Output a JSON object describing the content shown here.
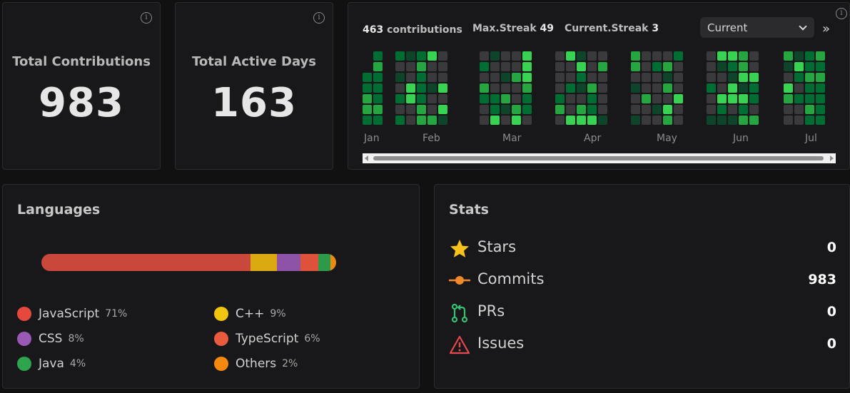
{
  "cards": {
    "total_contributions": {
      "label": "Total Contributions",
      "value": "983"
    },
    "total_active_days": {
      "label": "Total Active Days",
      "value": "163"
    }
  },
  "contributions": {
    "count_num": "463",
    "count_label": "contributions",
    "max_streak_label": "Max.Streak",
    "max_streak_value": "49",
    "current_streak_label": "Current.Streak",
    "current_streak_value": "3",
    "range_select": "Current",
    "months": [
      "Jan",
      "Feb",
      "Mar",
      "Apr",
      "May",
      "Jun",
      "Jul"
    ],
    "colors": {
      "empty": "#3a3a3c",
      "l1": "#0e4429",
      "l2": "#006d32",
      "l3": "#26a641",
      "l4": "#39d353"
    }
  },
  "languages": {
    "title": "Languages",
    "items": [
      {
        "name": "JavaScript",
        "pct": "71%",
        "share": 71,
        "color": "#e5493d"
      },
      {
        "name": "C++",
        "pct": "9%",
        "share": 9,
        "color": "#f1c40f"
      },
      {
        "name": "CSS",
        "pct": "8%",
        "share": 8,
        "color": "#9b59b6"
      },
      {
        "name": "TypeScript",
        "pct": "6%",
        "share": 6,
        "color": "#ea5a3d"
      },
      {
        "name": "Java",
        "pct": "4%",
        "share": 4,
        "color": "#2ea44f"
      },
      {
        "name": "Others",
        "pct": "2%",
        "share": 2,
        "color": "#f5880f"
      }
    ],
    "bar_colors": [
      "#c9483b",
      "#dba910",
      "#8e52a8",
      "#dd5238",
      "#2c9a48",
      "#ec8a12"
    ]
  },
  "stats": {
    "title": "Stats",
    "items": [
      {
        "label": "Stars",
        "value": "0",
        "icon": "star-icon"
      },
      {
        "label": "Commits",
        "value": "983",
        "icon": "commit-icon"
      },
      {
        "label": "PRs",
        "value": "0",
        "icon": "pull-request-icon"
      },
      {
        "label": "Issues",
        "value": "0",
        "icon": "warning-icon"
      }
    ]
  }
}
